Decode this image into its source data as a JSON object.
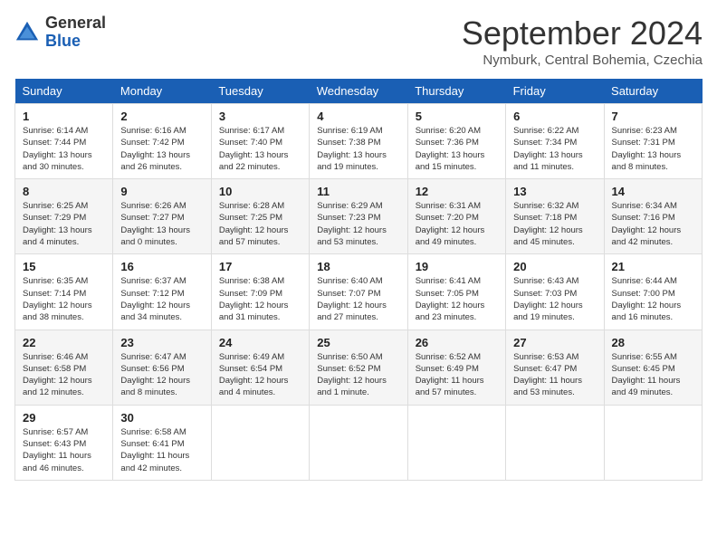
{
  "logo": {
    "general": "General",
    "blue": "Blue"
  },
  "title": "September 2024",
  "location": "Nymburk, Central Bohemia, Czechia",
  "days_of_week": [
    "Sunday",
    "Monday",
    "Tuesday",
    "Wednesday",
    "Thursday",
    "Friday",
    "Saturday"
  ],
  "weeks": [
    [
      {
        "day": 1,
        "rise": "6:14 AM",
        "set": "7:44 PM",
        "daylight": "13 hours and 30 minutes."
      },
      {
        "day": 2,
        "rise": "6:16 AM",
        "set": "7:42 PM",
        "daylight": "13 hours and 26 minutes."
      },
      {
        "day": 3,
        "rise": "6:17 AM",
        "set": "7:40 PM",
        "daylight": "13 hours and 22 minutes."
      },
      {
        "day": 4,
        "rise": "6:19 AM",
        "set": "7:38 PM",
        "daylight": "13 hours and 19 minutes."
      },
      {
        "day": 5,
        "rise": "6:20 AM",
        "set": "7:36 PM",
        "daylight": "13 hours and 15 minutes."
      },
      {
        "day": 6,
        "rise": "6:22 AM",
        "set": "7:34 PM",
        "daylight": "13 hours and 11 minutes."
      },
      {
        "day": 7,
        "rise": "6:23 AM",
        "set": "7:31 PM",
        "daylight": "13 hours and 8 minutes."
      }
    ],
    [
      {
        "day": 8,
        "rise": "6:25 AM",
        "set": "7:29 PM",
        "daylight": "13 hours and 4 minutes."
      },
      {
        "day": 9,
        "rise": "6:26 AM",
        "set": "7:27 PM",
        "daylight": "13 hours and 0 minutes."
      },
      {
        "day": 10,
        "rise": "6:28 AM",
        "set": "7:25 PM",
        "daylight": "12 hours and 57 minutes."
      },
      {
        "day": 11,
        "rise": "6:29 AM",
        "set": "7:23 PM",
        "daylight": "12 hours and 53 minutes."
      },
      {
        "day": 12,
        "rise": "6:31 AM",
        "set": "7:20 PM",
        "daylight": "12 hours and 49 minutes."
      },
      {
        "day": 13,
        "rise": "6:32 AM",
        "set": "7:18 PM",
        "daylight": "12 hours and 45 minutes."
      },
      {
        "day": 14,
        "rise": "6:34 AM",
        "set": "7:16 PM",
        "daylight": "12 hours and 42 minutes."
      }
    ],
    [
      {
        "day": 15,
        "rise": "6:35 AM",
        "set": "7:14 PM",
        "daylight": "12 hours and 38 minutes."
      },
      {
        "day": 16,
        "rise": "6:37 AM",
        "set": "7:12 PM",
        "daylight": "12 hours and 34 minutes."
      },
      {
        "day": 17,
        "rise": "6:38 AM",
        "set": "7:09 PM",
        "daylight": "12 hours and 31 minutes."
      },
      {
        "day": 18,
        "rise": "6:40 AM",
        "set": "7:07 PM",
        "daylight": "12 hours and 27 minutes."
      },
      {
        "day": 19,
        "rise": "6:41 AM",
        "set": "7:05 PM",
        "daylight": "12 hours and 23 minutes."
      },
      {
        "day": 20,
        "rise": "6:43 AM",
        "set": "7:03 PM",
        "daylight": "12 hours and 19 minutes."
      },
      {
        "day": 21,
        "rise": "6:44 AM",
        "set": "7:00 PM",
        "daylight": "12 hours and 16 minutes."
      }
    ],
    [
      {
        "day": 22,
        "rise": "6:46 AM",
        "set": "6:58 PM",
        "daylight": "12 hours and 12 minutes."
      },
      {
        "day": 23,
        "rise": "6:47 AM",
        "set": "6:56 PM",
        "daylight": "12 hours and 8 minutes."
      },
      {
        "day": 24,
        "rise": "6:49 AM",
        "set": "6:54 PM",
        "daylight": "12 hours and 4 minutes."
      },
      {
        "day": 25,
        "rise": "6:50 AM",
        "set": "6:52 PM",
        "daylight": "12 hours and 1 minute."
      },
      {
        "day": 26,
        "rise": "6:52 AM",
        "set": "6:49 PM",
        "daylight": "11 hours and 57 minutes."
      },
      {
        "day": 27,
        "rise": "6:53 AM",
        "set": "6:47 PM",
        "daylight": "11 hours and 53 minutes."
      },
      {
        "day": 28,
        "rise": "6:55 AM",
        "set": "6:45 PM",
        "daylight": "11 hours and 49 minutes."
      }
    ],
    [
      {
        "day": 29,
        "rise": "6:57 AM",
        "set": "6:43 PM",
        "daylight": "11 hours and 46 minutes."
      },
      {
        "day": 30,
        "rise": "6:58 AM",
        "set": "6:41 PM",
        "daylight": "11 hours and 42 minutes."
      },
      null,
      null,
      null,
      null,
      null
    ]
  ]
}
